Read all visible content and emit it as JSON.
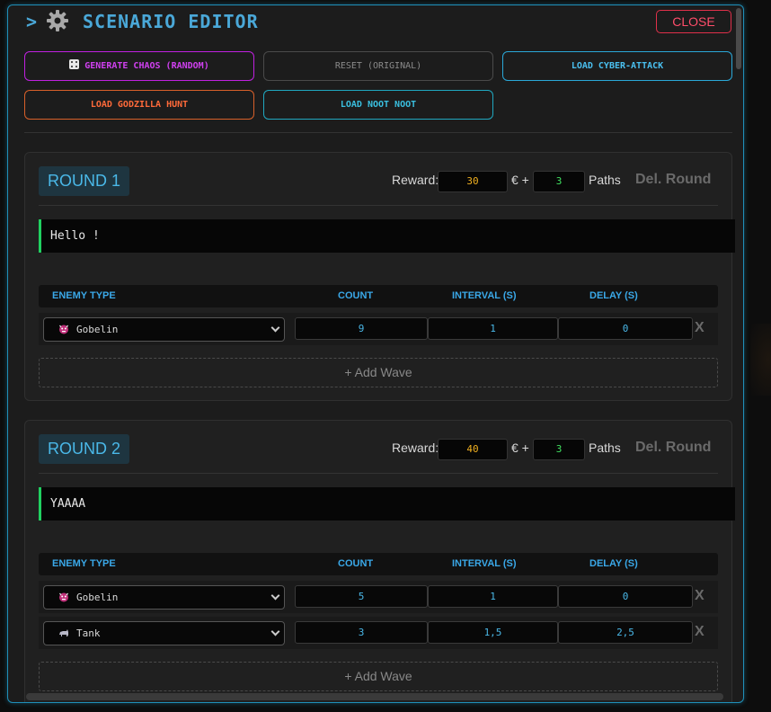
{
  "header": {
    "caret": ">",
    "title": "SCENARIO EDITOR",
    "close_label": "CLOSE"
  },
  "presets": {
    "generate_chaos": "GENERATE CHAOS (RANDOM)",
    "reset": "RESET (ORIGINAL)",
    "load_cyber_attack": "LOAD CYBER-ATTACK",
    "load_godzilla": "LOAD GODZILLA HUNT",
    "load_noot": "LOAD NOOT NOOT"
  },
  "labels": {
    "reward": "Reward:",
    "euro_plus": "€ +",
    "paths": "Paths",
    "delete_round": "Del. Round",
    "add_wave": "+ Add Wave",
    "remove_wave": "X"
  },
  "table_headers": {
    "enemy_type": "ENEMY TYPE",
    "count": "COUNT",
    "interval": "INTERVAL (S)",
    "delay": "DELAY (S)"
  },
  "rounds": [
    {
      "label": "ROUND 1",
      "reward_money": "30",
      "reward_paths": "3",
      "message": "Hello !",
      "waves": [
        {
          "enemy": "Gobelin",
          "icon": "ogre-face-icon",
          "count": "9",
          "interval": "1",
          "delay": "0"
        }
      ]
    },
    {
      "label": "ROUND 2",
      "reward_money": "40",
      "reward_paths": "3",
      "message": "YAAAA",
      "waves": [
        {
          "enemy": "Gobelin",
          "icon": "ogre-face-icon",
          "count": "5",
          "interval": "1",
          "delay": "0"
        },
        {
          "enemy": "Tank",
          "icon": "rhino-icon",
          "count": "3",
          "interval": "1,5",
          "delay": "2,5"
        }
      ]
    }
  ],
  "colors": {
    "accent": "#4aa8d8",
    "close": "#ff4d6a",
    "chaos": "#d040f0",
    "godzilla": "#ff6a3a",
    "money": "#f0b020",
    "paths": "#40e060"
  }
}
